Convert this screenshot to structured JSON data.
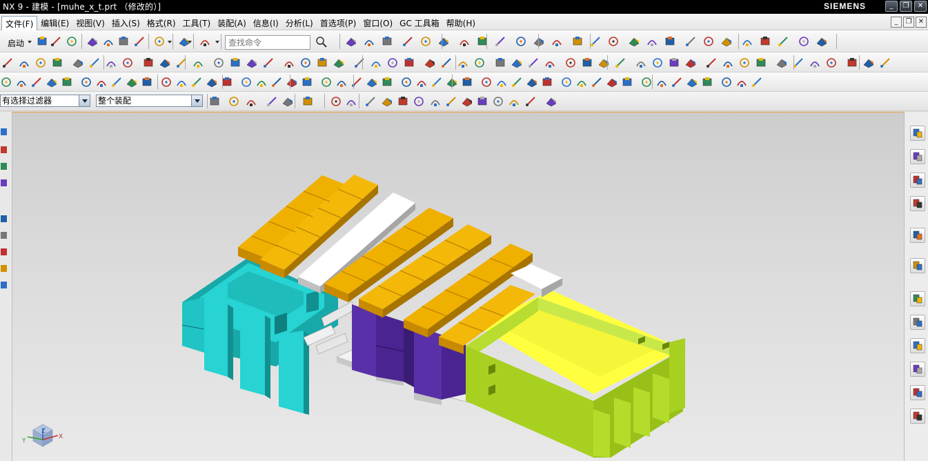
{
  "window": {
    "title": "NX 9 - 建模 - [muhe_x_t.prt （修改的）]",
    "brand": "SIEMENS",
    "controls": {
      "minimize": "_",
      "maximize": "❐",
      "close": "✕"
    }
  },
  "menu": {
    "items": [
      "文件(F)",
      "编辑(E)",
      "视图(V)",
      "插入(S)",
      "格式(R)",
      "工具(T)",
      "装配(A)",
      "信息(I)",
      "分析(L)",
      "首选项(P)",
      "窗口(O)",
      "GC 工具箱",
      "帮助(H)"
    ],
    "active_index": 0
  },
  "toolbar": {
    "start_label": "启动",
    "search_placeholder": "查找命令"
  },
  "selection_bar": {
    "filter_value": "有选择过滤器",
    "scope_value": "整个装配"
  },
  "right_resource_bar": {
    "icons": [
      "assembly-navigator-icon",
      "constraint-navigator-icon",
      "part-navigator-icon",
      "reuse-library-icon",
      "hd3d-tools-icon",
      "web-browser-icon",
      "history-icon",
      "system-materials-icon",
      "process-studio-icon",
      "manufacturing-wizard-icon",
      "roles-icon",
      "system-scenes-icon"
    ]
  },
  "model": {
    "colors": {
      "orange_top": "#f0b000",
      "orange_side": "#c88a00",
      "white_top": "#ffffff",
      "white_side": "#bfbfbf",
      "cyan_top": "#27d3d3",
      "cyan_side": "#18a8a8",
      "purple_top": "#6a3cc0",
      "purple_side": "#4a2490",
      "yellow_inner": "#ffff40",
      "lime_side": "#a8d020",
      "lime_dark": "#86ac10"
    }
  },
  "triad": {
    "x": "X",
    "y": "Y",
    "z": "Z"
  }
}
